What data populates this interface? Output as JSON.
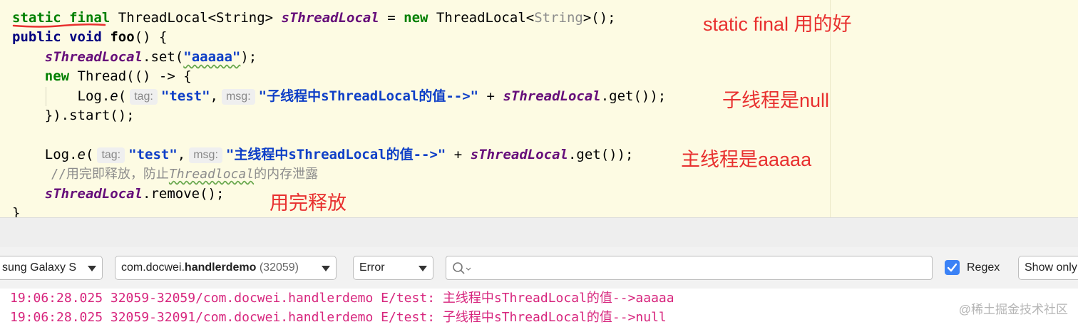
{
  "editor": {
    "line1": {
      "kw_static": "static",
      "kw_final": "final",
      "type": "ThreadLocal<String>",
      "field": "sThreadLocal",
      "eq": " = ",
      "kw_new": "new",
      "ctor_a": " ThreadLocal<",
      "ctor_generic": "String",
      "ctor_b": ">();"
    },
    "line2": {
      "kw_public": "public",
      "kw_void": "void",
      "method": "foo",
      "rest": "() {"
    },
    "line3": {
      "field": "sThreadLocal",
      "call": ".set(",
      "arg": "\"aaaaa\"",
      "end": ");"
    },
    "line4": {
      "kw_new": "new",
      "rest": " Thread(() -> {"
    },
    "line5": {
      "log": "Log.",
      "method": "e",
      "paren": "(",
      "tag_hint": "tag:",
      "tag_value": "\"test\"",
      "comma": ",",
      "msg_hint": "msg:",
      "msg_value": "\"子线程中sThreadLocal的值-->\"",
      "plus": " + ",
      "field": "sThreadLocal",
      "end": ".get());"
    },
    "line6": {
      "text": "}).start();"
    },
    "line8": {
      "log": "Log.",
      "method": "e",
      "paren": "(",
      "tag_hint": "tag:",
      "tag_value": "\"test\"",
      "comma": ",",
      "msg_hint": "msg:",
      "msg_value": "\"主线程中sThreadLocal的值-->\"",
      "plus": " + ",
      "field": "sThreadLocal",
      "end": ".get());"
    },
    "line9": {
      "prefix": "//用完即释放，防止",
      "wavy": "Threadlocal",
      "suffix": "的内存泄露"
    },
    "line10": {
      "field": "sThreadLocal",
      "end": ".remove();"
    },
    "line11": {
      "text": "}"
    }
  },
  "annotations": {
    "a1": "static final 用的好",
    "a2": "子线程是null",
    "a3": "主线程是aaaaa",
    "a4": "用完释放"
  },
  "logcat": {
    "device": "sung Galaxy S",
    "process_package_prefix": "com.docwei.",
    "process_package_bold": "handlerdemo",
    "process_pid": "(32059)",
    "level": "Error",
    "search_value": "",
    "regex_label": "Regex",
    "regex_checked": true,
    "show_only_label": "Show only",
    "lines": [
      "19:06:28.025 32059-32059/com.docwei.handlerdemo E/test: 主线程中sThreadLocal的值-->aaaaa",
      "19:06:28.025 32059-32091/com.docwei.handlerdemo E/test: 子线程中sThreadLocal的值-->null"
    ]
  },
  "watermark": "@稀土掘金技术社区",
  "colors": {
    "editor_bg": "#fdfbe3",
    "keyword": "#000080",
    "new_keyword": "#008000",
    "field": "#660e7a",
    "string": "#0e3fc7",
    "annotation": "#e8302f",
    "log_error": "#d7257d",
    "checkbox": "#3b82f6"
  }
}
